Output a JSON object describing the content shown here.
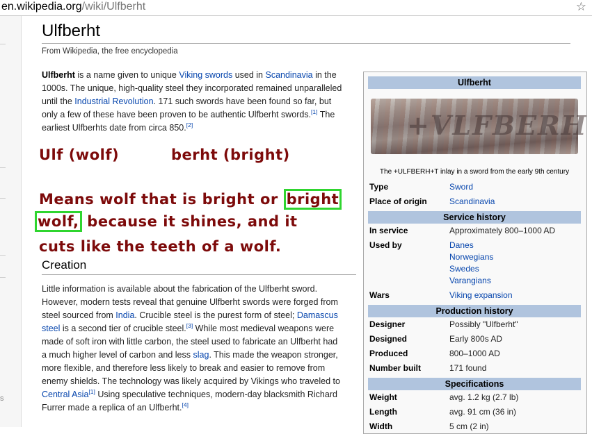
{
  "browser": {
    "url_host": "en.wikipedia.org",
    "url_path": "/wiki/Ulfberht",
    "star_icon": "star-icon"
  },
  "article": {
    "title": "Ulfberht",
    "tagline": "From Wikipedia, the free encyclopedia",
    "intro": {
      "bold_term": "Ulfberht",
      "t1": " is a name given to unique ",
      "link_viking_swords": "Viking swords",
      "t2": " used in ",
      "link_scandinavia": "Scandinavia",
      "t3": " in the",
      "t4": "1000s. The unique, high-quality steel they incorporated remained unparalleled",
      "t5": "until the ",
      "link_industrial_revolution": "Industrial Revolution",
      "t6": ". 171 such swords have been found so far, but",
      "t7": "only a few of these have been proven to be authentic Ulfberht swords.",
      "ref1": "[1]",
      "t8": " The",
      "t9": "earliest Ulfberhts date from circa 850.",
      "ref2": "[2]"
    },
    "annotation": {
      "ulf": "Ulf (wolf)",
      "berht": "berht (bright)",
      "l1a": "Means wolf that is bright or ",
      "l1b": "bright",
      "l2a": "wolf,",
      "l2b": " because it shines, and it",
      "l3": "cuts like the teeth of a wolf.",
      "highlight_color": "#2fd52f",
      "text_color": "#7d0a0a"
    },
    "creation": {
      "heading": "Creation",
      "l1": "Little information is available about the fabrication of the Ulfberht sword.",
      "l2": "However, modern tests reveal that genuine Ulfberht swords were forged from",
      "l3a": "steel sourced from ",
      "link_india": "India",
      "l3b": ". Crucible steel is the purest form of steel; ",
      "link_damascus1": "Damascus",
      "link_damascus2": "steel",
      "l4b": " is a second tier of crucible steel.",
      "ref3": "[3]",
      "l4c": " While most medieval weapons were",
      "l5": "made of soft iron with little carbon, the steel used to fabricate an Ulfberht had",
      "l6a": "a much higher level of carbon and less ",
      "link_slag": "slag",
      "l6b": ". This made the weapon stronger,",
      "l7": "more flexible, and therefore less likely to break and easier to remove from",
      "l8": "enemy shields. The technology was likely acquired by Vikings who traveled to",
      "link_central_asia": "Central Asia",
      "ref1b": "[1]",
      "l9b": " Using speculative techniques, modern-day blacksmith Richard",
      "l10": "Furrer made a replica of an Ulfberht.",
      "ref4": "[4]"
    }
  },
  "infobox": {
    "title": "Ulfberht",
    "image_caption": "The +ULFBERH+T inlay in a sword from the early 9th century",
    "image_inlay_text": "+VLFBERH+T",
    "rows_top": [
      {
        "label": "Type",
        "value": "Sword",
        "link": true
      },
      {
        "label": "Place of origin",
        "value": "Scandinavia",
        "link": true
      }
    ],
    "service_history": {
      "heading": "Service history",
      "in_service_label": "In service",
      "in_service_value": "Approximately 800–1000 AD",
      "used_by_label": "Used by",
      "used_by": [
        "Danes",
        "Norwegians",
        "Swedes",
        "Varangians"
      ],
      "wars_label": "Wars",
      "wars_value": "Viking expansion"
    },
    "production_history": {
      "heading": "Production history",
      "rows": [
        {
          "label": "Designer",
          "value": "Possibly \"Ulfberht\""
        },
        {
          "label": "Designed",
          "value": "Early 800s AD"
        },
        {
          "label": "Produced",
          "value": "800–1000 AD"
        },
        {
          "label": "Number built",
          "value": "171 found"
        }
      ]
    },
    "specifications": {
      "heading": "Specifications",
      "rows": [
        {
          "label": "Weight",
          "value": "avg. 1.2 kg (2.7 lb)"
        },
        {
          "label": "Length",
          "value": "avg. 91 cm (36 in)"
        },
        {
          "label": "Width",
          "value": "5 cm (2 in)"
        }
      ]
    },
    "header_color": "#b0c4de"
  },
  "left_panel": {
    "glyph": "s"
  }
}
